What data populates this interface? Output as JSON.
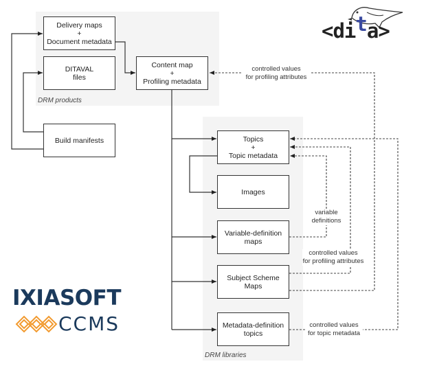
{
  "regions": {
    "products": {
      "label": "DRM products"
    },
    "libraries": {
      "label": "DRM libraries"
    }
  },
  "nodes": {
    "delivery_maps": {
      "line1": "Delivery maps",
      "line2": "+",
      "line3": "Document metadata"
    },
    "ditaval": {
      "line1": "DITAVAL",
      "line2": "files"
    },
    "content_map": {
      "line1": "Content map",
      "line2": "+",
      "line3": "Profiling metadata"
    },
    "build_manifests": {
      "line1": "Build manifests"
    },
    "topics": {
      "line1": "Topics",
      "line2": "+",
      "line3": "Topic metadata"
    },
    "images": {
      "line1": "Images"
    },
    "variable_maps": {
      "line1": "Variable-definition",
      "line2": "maps"
    },
    "subject_scheme": {
      "line1": "Subject Scheme",
      "line2": "Maps"
    },
    "metadata_topics": {
      "line1": "Metadata-definition",
      "line2": "topics"
    }
  },
  "edge_labels": {
    "profiling_top": {
      "line1": "controlled values",
      "line2": "for profiling attributes"
    },
    "variable_defs": {
      "line1": "variable",
      "line2": "definitions"
    },
    "profiling_mid": {
      "line1": "controlled values",
      "line2": "for profiling attributes"
    },
    "topic_metadata": {
      "line1": "controlled values",
      "line2": "for topic metadata"
    }
  },
  "logos": {
    "dita": {
      "prefix": "<di",
      "t": "t",
      "suffix": "a>"
    },
    "ixiasoft": {
      "name": "IXIASOFT",
      "product": "CCMS"
    }
  },
  "colors": {
    "ixiasoft_blue": "#1b3a5c",
    "ixiasoft_orange": "#f29a2e",
    "dita_blue": "#3a4aa0"
  }
}
